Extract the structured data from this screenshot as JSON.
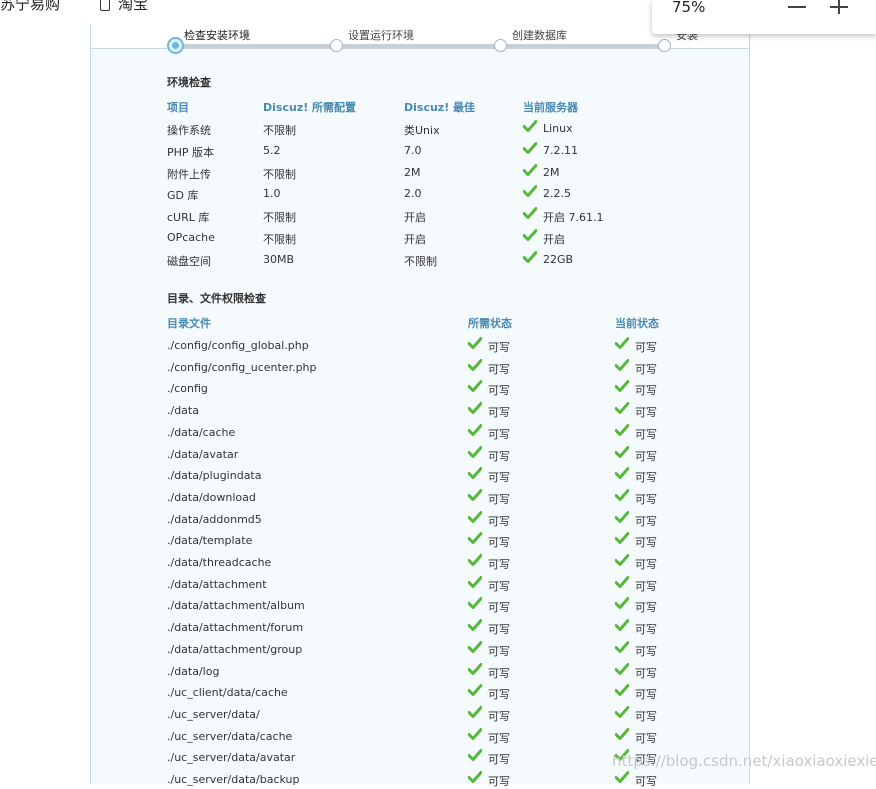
{
  "bookmarks": [
    {
      "label": "苏宁易购"
    },
    {
      "label": "淘宝"
    }
  ],
  "zoom": {
    "value": "75%",
    "minus_label": "—",
    "plus_label": "+"
  },
  "steps": [
    {
      "label": "检查安装环境",
      "state": "current"
    },
    {
      "label": "设置运行环境",
      "state": "pending"
    },
    {
      "label": "创建数据库",
      "state": "pending"
    },
    {
      "label": "安装",
      "state": "pending"
    }
  ],
  "env_check": {
    "title": "环境检查",
    "headers": [
      "项目",
      "Discuz! 所需配置",
      "Discuz! 最佳",
      "当前服务器"
    ],
    "rows": [
      {
        "item": "操作系统",
        "required": "不限制",
        "best": "类Unix",
        "current": "Linux",
        "ok": true
      },
      {
        "item": "PHP 版本",
        "required": "5.2",
        "best": "7.0",
        "current": "7.2.11",
        "ok": true
      },
      {
        "item": "附件上传",
        "required": "不限制",
        "best": "2M",
        "current": "2M",
        "ok": true
      },
      {
        "item": "GD 库",
        "required": "1.0",
        "best": "2.0",
        "current": "2.2.5",
        "ok": true
      },
      {
        "item": "cURL 库",
        "required": "不限制",
        "best": "开启",
        "current": "开启 7.61.1",
        "ok": true
      },
      {
        "item": "OPcache",
        "required": "不限制",
        "best": "开启",
        "current": "开启",
        "ok": true
      },
      {
        "item": "磁盘空间",
        "required": "30MB",
        "best": "不限制",
        "current": "22GB",
        "ok": true
      }
    ]
  },
  "dir_check": {
    "title": "目录、文件权限检查",
    "headers": [
      "目录文件",
      "所需状态",
      "当前状态"
    ],
    "rows": [
      {
        "path": "./config/config_global.php",
        "required": "可写",
        "current": "可写"
      },
      {
        "path": "./config/config_ucenter.php",
        "required": "可写",
        "current": "可写"
      },
      {
        "path": "./config",
        "required": "可写",
        "current": "可写"
      },
      {
        "path": "./data",
        "required": "可写",
        "current": "可写"
      },
      {
        "path": "./data/cache",
        "required": "可写",
        "current": "可写"
      },
      {
        "path": "./data/avatar",
        "required": "可写",
        "current": "可写"
      },
      {
        "path": "./data/plugindata",
        "required": "可写",
        "current": "可写"
      },
      {
        "path": "./data/download",
        "required": "可写",
        "current": "可写"
      },
      {
        "path": "./data/addonmd5",
        "required": "可写",
        "current": "可写"
      },
      {
        "path": "./data/template",
        "required": "可写",
        "current": "可写"
      },
      {
        "path": "./data/threadcache",
        "required": "可写",
        "current": "可写"
      },
      {
        "path": "./data/attachment",
        "required": "可写",
        "current": "可写"
      },
      {
        "path": "./data/attachment/album",
        "required": "可写",
        "current": "可写"
      },
      {
        "path": "./data/attachment/forum",
        "required": "可写",
        "current": "可写"
      },
      {
        "path": "./data/attachment/group",
        "required": "可写",
        "current": "可写"
      },
      {
        "path": "./data/log",
        "required": "可写",
        "current": "可写"
      },
      {
        "path": "./uc_client/data/cache",
        "required": "可写",
        "current": "可写"
      },
      {
        "path": "./uc_server/data/",
        "required": "可写",
        "current": "可写"
      },
      {
        "path": "./uc_server/data/cache",
        "required": "可写",
        "current": "可写"
      },
      {
        "path": "./uc_server/data/avatar",
        "required": "可写",
        "current": "可写"
      },
      {
        "path": "./uc_server/data/backup",
        "required": "可写",
        "current": "可写"
      }
    ]
  },
  "watermark": "https://blog.csdn.net/xiaoxiaoxiexies",
  "colors": {
    "accent": "#4a8ab3",
    "ok_green": "#55b83a",
    "progress": "#6fb7e0"
  }
}
